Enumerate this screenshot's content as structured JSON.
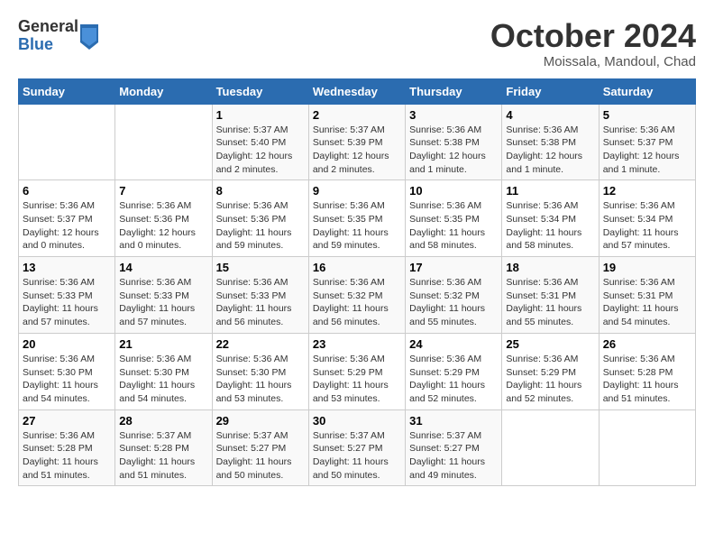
{
  "header": {
    "logo": {
      "general": "General",
      "blue": "Blue"
    },
    "title": "October 2024",
    "location": "Moissala, Mandoul, Chad"
  },
  "weekdays": [
    "Sunday",
    "Monday",
    "Tuesday",
    "Wednesday",
    "Thursday",
    "Friday",
    "Saturday"
  ],
  "weeks": [
    [
      {
        "day": "",
        "info": ""
      },
      {
        "day": "",
        "info": ""
      },
      {
        "day": "1",
        "info": "Sunrise: 5:37 AM\nSunset: 5:40 PM\nDaylight: 12 hours and 2 minutes."
      },
      {
        "day": "2",
        "info": "Sunrise: 5:37 AM\nSunset: 5:39 PM\nDaylight: 12 hours and 2 minutes."
      },
      {
        "day": "3",
        "info": "Sunrise: 5:36 AM\nSunset: 5:38 PM\nDaylight: 12 hours and 1 minute."
      },
      {
        "day": "4",
        "info": "Sunrise: 5:36 AM\nSunset: 5:38 PM\nDaylight: 12 hours and 1 minute."
      },
      {
        "day": "5",
        "info": "Sunrise: 5:36 AM\nSunset: 5:37 PM\nDaylight: 12 hours and 1 minute."
      }
    ],
    [
      {
        "day": "6",
        "info": "Sunrise: 5:36 AM\nSunset: 5:37 PM\nDaylight: 12 hours and 0 minutes."
      },
      {
        "day": "7",
        "info": "Sunrise: 5:36 AM\nSunset: 5:36 PM\nDaylight: 12 hours and 0 minutes."
      },
      {
        "day": "8",
        "info": "Sunrise: 5:36 AM\nSunset: 5:36 PM\nDaylight: 11 hours and 59 minutes."
      },
      {
        "day": "9",
        "info": "Sunrise: 5:36 AM\nSunset: 5:35 PM\nDaylight: 11 hours and 59 minutes."
      },
      {
        "day": "10",
        "info": "Sunrise: 5:36 AM\nSunset: 5:35 PM\nDaylight: 11 hours and 58 minutes."
      },
      {
        "day": "11",
        "info": "Sunrise: 5:36 AM\nSunset: 5:34 PM\nDaylight: 11 hours and 58 minutes."
      },
      {
        "day": "12",
        "info": "Sunrise: 5:36 AM\nSunset: 5:34 PM\nDaylight: 11 hours and 57 minutes."
      }
    ],
    [
      {
        "day": "13",
        "info": "Sunrise: 5:36 AM\nSunset: 5:33 PM\nDaylight: 11 hours and 57 minutes."
      },
      {
        "day": "14",
        "info": "Sunrise: 5:36 AM\nSunset: 5:33 PM\nDaylight: 11 hours and 57 minutes."
      },
      {
        "day": "15",
        "info": "Sunrise: 5:36 AM\nSunset: 5:33 PM\nDaylight: 11 hours and 56 minutes."
      },
      {
        "day": "16",
        "info": "Sunrise: 5:36 AM\nSunset: 5:32 PM\nDaylight: 11 hours and 56 minutes."
      },
      {
        "day": "17",
        "info": "Sunrise: 5:36 AM\nSunset: 5:32 PM\nDaylight: 11 hours and 55 minutes."
      },
      {
        "day": "18",
        "info": "Sunrise: 5:36 AM\nSunset: 5:31 PM\nDaylight: 11 hours and 55 minutes."
      },
      {
        "day": "19",
        "info": "Sunrise: 5:36 AM\nSunset: 5:31 PM\nDaylight: 11 hours and 54 minutes."
      }
    ],
    [
      {
        "day": "20",
        "info": "Sunrise: 5:36 AM\nSunset: 5:30 PM\nDaylight: 11 hours and 54 minutes."
      },
      {
        "day": "21",
        "info": "Sunrise: 5:36 AM\nSunset: 5:30 PM\nDaylight: 11 hours and 54 minutes."
      },
      {
        "day": "22",
        "info": "Sunrise: 5:36 AM\nSunset: 5:30 PM\nDaylight: 11 hours and 53 minutes."
      },
      {
        "day": "23",
        "info": "Sunrise: 5:36 AM\nSunset: 5:29 PM\nDaylight: 11 hours and 53 minutes."
      },
      {
        "day": "24",
        "info": "Sunrise: 5:36 AM\nSunset: 5:29 PM\nDaylight: 11 hours and 52 minutes."
      },
      {
        "day": "25",
        "info": "Sunrise: 5:36 AM\nSunset: 5:29 PM\nDaylight: 11 hours and 52 minutes."
      },
      {
        "day": "26",
        "info": "Sunrise: 5:36 AM\nSunset: 5:28 PM\nDaylight: 11 hours and 51 minutes."
      }
    ],
    [
      {
        "day": "27",
        "info": "Sunrise: 5:36 AM\nSunset: 5:28 PM\nDaylight: 11 hours and 51 minutes."
      },
      {
        "day": "28",
        "info": "Sunrise: 5:37 AM\nSunset: 5:28 PM\nDaylight: 11 hours and 51 minutes."
      },
      {
        "day": "29",
        "info": "Sunrise: 5:37 AM\nSunset: 5:27 PM\nDaylight: 11 hours and 50 minutes."
      },
      {
        "day": "30",
        "info": "Sunrise: 5:37 AM\nSunset: 5:27 PM\nDaylight: 11 hours and 50 minutes."
      },
      {
        "day": "31",
        "info": "Sunrise: 5:37 AM\nSunset: 5:27 PM\nDaylight: 11 hours and 49 minutes."
      },
      {
        "day": "",
        "info": ""
      },
      {
        "day": "",
        "info": ""
      }
    ]
  ]
}
